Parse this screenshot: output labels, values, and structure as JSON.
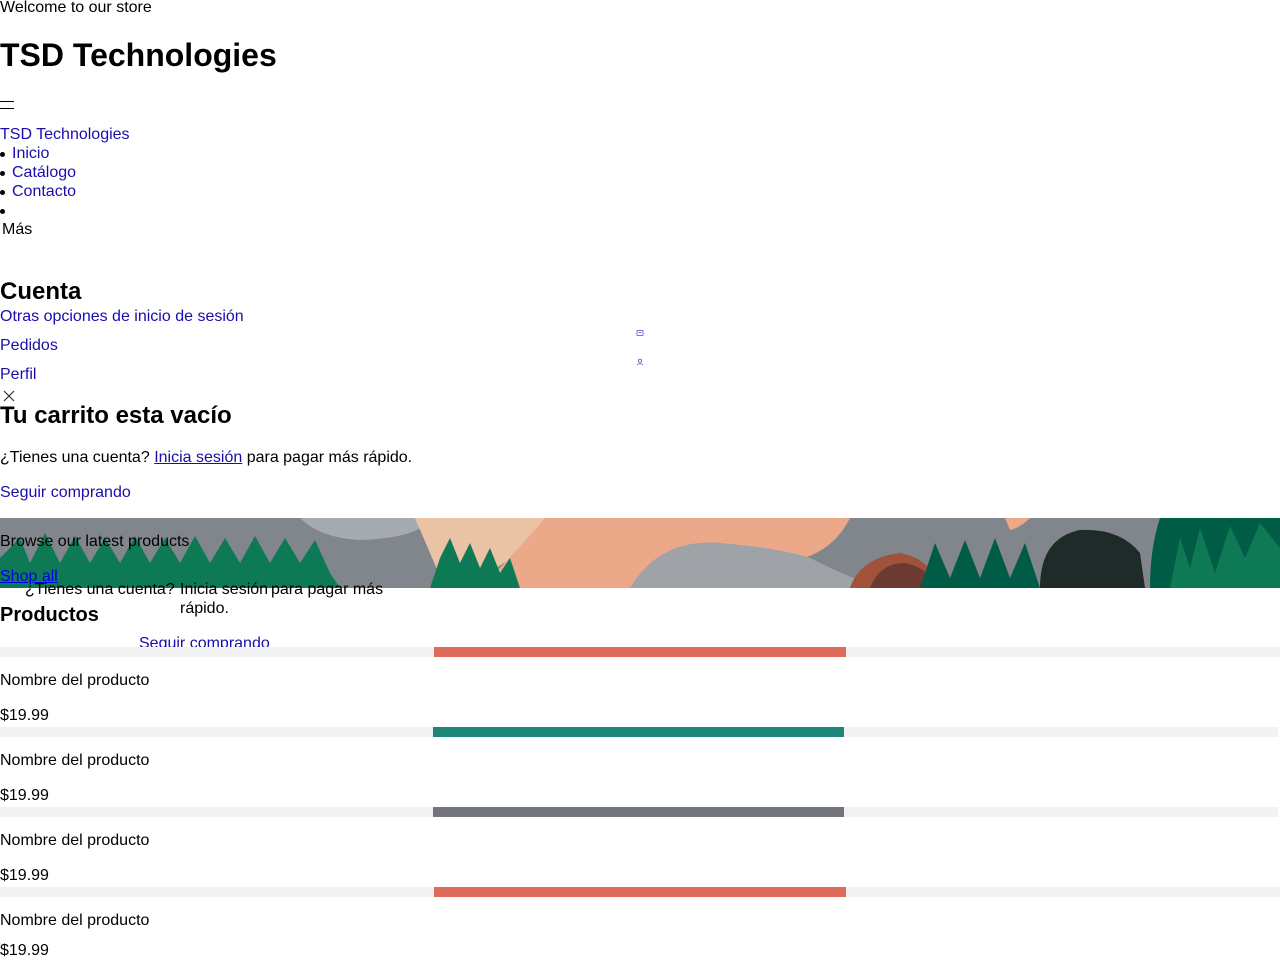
{
  "announcement": "Welcome to our store",
  "store_title": "TSD Technologies",
  "header": {
    "brand_link": "TSD Technologies",
    "nav": [
      "Inicio",
      "Catálogo",
      "Contacto",
      ""
    ],
    "more_label": "Más"
  },
  "account": {
    "title": "Cuenta",
    "links": [
      "Otras opciones de inicio de sesión",
      "Pedidos",
      "Perfil"
    ],
    "icons": [
      "orders-icon",
      "profile-icon"
    ]
  },
  "cart": {
    "title": "Tu carrito esta vacío",
    "prompt_prefix": "¿Tienes una cuenta?",
    "login_link": "Inicia sesión",
    "prompt_suffix": "para pagar más rápido.",
    "continue": "Seguir comprando",
    "close_icon": "close-icon"
  },
  "cart_overlay": {
    "prompt_prefix": "¿Tienes una cuenta?",
    "login_link": "Inicia sesión",
    "prompt_suffix_line1": "para pagar más",
    "prompt_suffix_line2": "rápido.",
    "continue": "Seguir comprando"
  },
  "hero": {
    "text": "Browse our latest products",
    "button": "Shop all",
    "colors": {
      "grey": "#80868b",
      "peach": "#eca98a",
      "green": "#0e7a55",
      "dark_green": "#005c45",
      "brown": "#a1523b"
    }
  },
  "products": {
    "title": "Productos",
    "items": [
      {
        "name": "Nombre del producto",
        "price": "$19.99",
        "color": "#de6c5b"
      },
      {
        "name": "Nombre del producto",
        "price": "$19.99",
        "color": "#1d877a"
      },
      {
        "name": "Nombre del producto",
        "price": "$19.99",
        "color": "#72767a"
      },
      {
        "name": "Nombre del producto",
        "price": "$19.99",
        "color": "#de6c5b"
      }
    ]
  }
}
